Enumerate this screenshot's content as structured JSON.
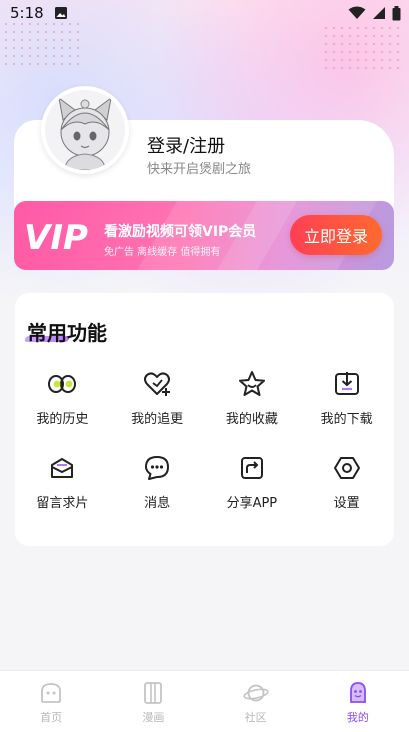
{
  "status_bar": {
    "time": "5:18",
    "icons": [
      "image-icon",
      "wifi-icon",
      "signal-icon",
      "battery-icon"
    ]
  },
  "profile": {
    "login_title": "登录/注册",
    "login_subtitle": "快来开启煲剧之旅",
    "avatar": "avatar-anime-girl"
  },
  "vip_banner": {
    "logo_text": "VIP",
    "title": "看激励视频可领VIP会员",
    "subtitle": "免广告 离线缓存 值得拥有",
    "button_label": "立即登录"
  },
  "functions": {
    "title": "常用功能",
    "items": [
      {
        "label": "我的历史",
        "icon": "eyes-icon"
      },
      {
        "label": "我的追更",
        "icon": "heart-plus-icon"
      },
      {
        "label": "我的收藏",
        "icon": "star-icon"
      },
      {
        "label": "我的下载",
        "icon": "download-icon"
      },
      {
        "label": "留言求片",
        "icon": "message-box-icon"
      },
      {
        "label": "消息",
        "icon": "chat-icon"
      },
      {
        "label": "分享APP",
        "icon": "share-icon"
      },
      {
        "label": "设置",
        "icon": "settings-icon"
      }
    ]
  },
  "bottom_nav": {
    "items": [
      {
        "label": "首页",
        "icon": "home-icon",
        "active": false
      },
      {
        "label": "漫画",
        "icon": "comic-icon",
        "active": false
      },
      {
        "label": "社区",
        "icon": "planet-icon",
        "active": false
      },
      {
        "label": "我的",
        "icon": "profile-icon",
        "active": true
      }
    ]
  },
  "colors": {
    "accent": "#8b4df0",
    "vip_gradient_start": "#ff5aa5",
    "login_button": "#ff4a4a",
    "icon_dark": "#222222"
  }
}
